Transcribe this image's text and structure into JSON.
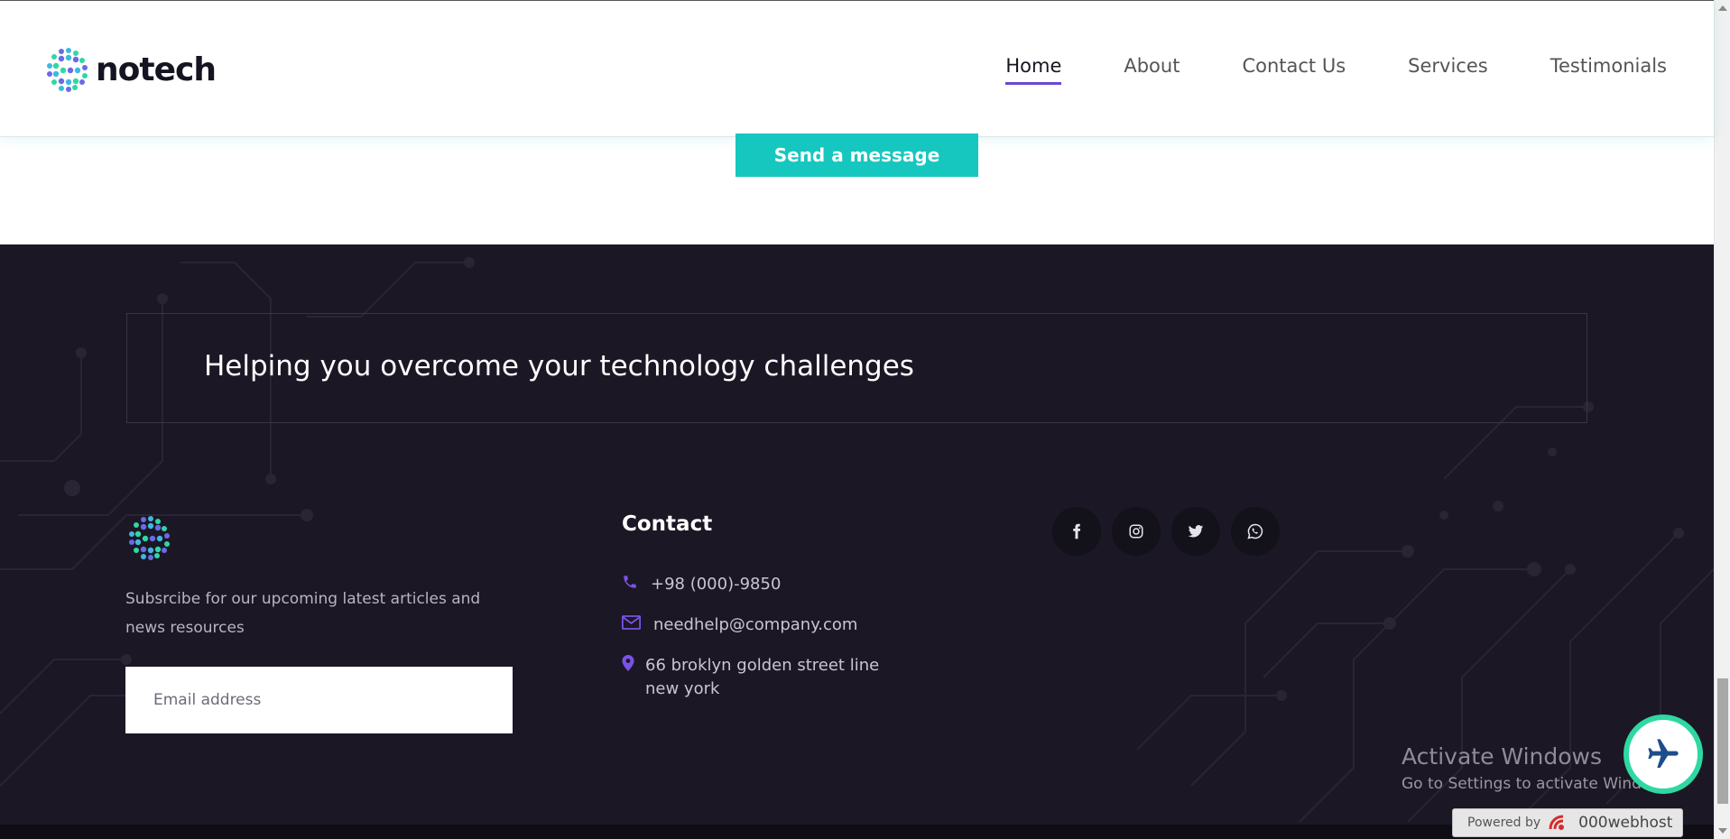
{
  "header": {
    "logo_text": "notech",
    "nav": [
      {
        "label": "Home",
        "active": true
      },
      {
        "label": "About",
        "active": false
      },
      {
        "label": "Contact Us",
        "active": false
      },
      {
        "label": "Services",
        "active": false
      },
      {
        "label": "Testimonials",
        "active": false
      }
    ]
  },
  "form": {
    "send_label": "Send a message"
  },
  "footer": {
    "tagline": "Helping you overcome your technology challenges",
    "subscribe_text": "Subsrcibe for our upcoming latest articles and news resources",
    "email_placeholder": "Email address",
    "contact": {
      "title": "Contact",
      "phone": "+98 (000)-9850",
      "email": "needhelp@company.com",
      "address": "66 broklyn golden street line new york"
    },
    "socials": [
      "facebook-icon",
      "instagram-icon",
      "twitter-icon",
      "whatsapp-icon"
    ]
  },
  "overlay": {
    "activate_title": "Activate Windows",
    "activate_sub": "Go to Settings to activate Windows.",
    "powered_by": "Powered by",
    "powered_brand": "000webhost"
  },
  "colors": {
    "accent_teal": "#16c7bf",
    "nav_underline": "#6a46d6",
    "footer_bg": "#1b1725",
    "icon_purple": "#7b52e8"
  }
}
